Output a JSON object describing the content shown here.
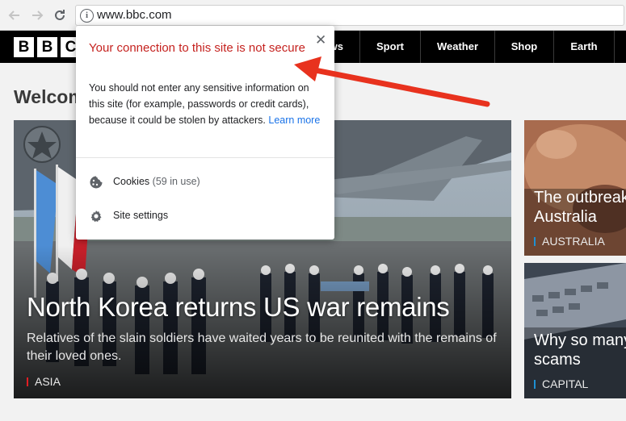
{
  "browser": {
    "url": "www.bbc.com",
    "back_icon": "arrow-left-icon",
    "forward_icon": "arrow-right-icon",
    "reload_icon": "reload-icon",
    "info_icon": "info-icon",
    "info_glyph": "i"
  },
  "bbc": {
    "logo": [
      "B",
      "B",
      "C"
    ],
    "nav": [
      "ws",
      "Sport",
      "Weather",
      "Shop",
      "Earth"
    ]
  },
  "page": {
    "welcome": "Welcom"
  },
  "hero": {
    "title": "North Korea returns US war remains",
    "summary": "Relatives of the slain soldiers have waited years to be reunited with the remains of their loved ones.",
    "tag": "ASIA",
    "tag_color": "#e21e23"
  },
  "side_cards": [
    {
      "title_lines": [
        "The outbreak",
        "Australia"
      ],
      "tag": "AUSTRALIA",
      "tag_color": "#1e90d2"
    },
    {
      "title_lines": [
        "Why so many",
        "scams"
      ],
      "tag": "CAPITAL",
      "tag_color": "#1e90d2"
    }
  ],
  "popup": {
    "title": "Your connection to this site is not secure",
    "body": "You should not enter any sensitive information on this site (for example, passwords or credit cards), because it could be stolen by attackers.",
    "link": "Learn more",
    "close_glyph": "✕",
    "cookies_label": "Cookies",
    "cookies_count": "(59 in use)",
    "site_settings_label": "Site settings",
    "title_color": "#c5221f",
    "link_color": "#1a73e8"
  },
  "annotation": {
    "arrow_color": "#e8321e"
  }
}
